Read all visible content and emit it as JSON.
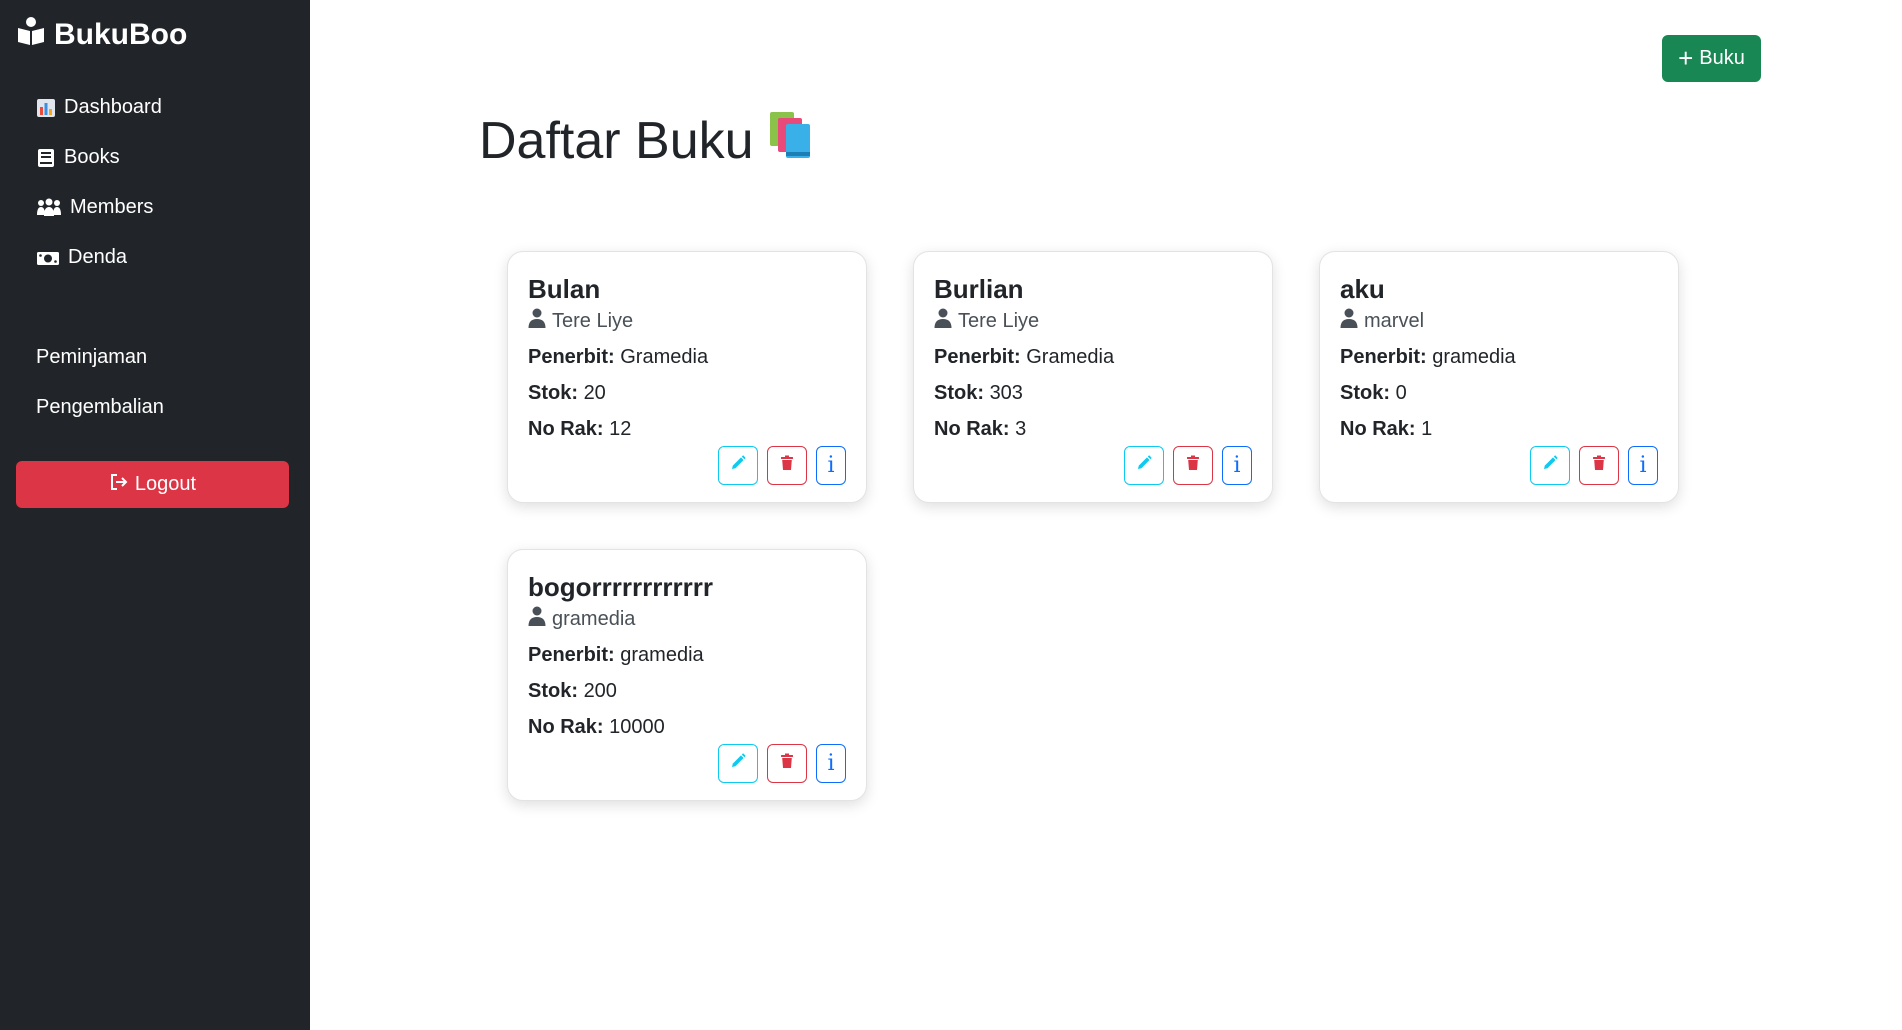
{
  "brand": {
    "name": "BukuBoo",
    "icon": "open-book-reader-icon"
  },
  "sidebar": {
    "items": [
      {
        "label": "Dashboard",
        "icon": "bar-chart-icon"
      },
      {
        "label": "Books",
        "icon": "book-icon"
      },
      {
        "label": "Members",
        "icon": "people-group-icon"
      },
      {
        "label": "Denda",
        "icon": "money-bill-icon"
      },
      {
        "label": "Peminjaman"
      },
      {
        "label": "Pengembalian"
      }
    ],
    "logout_label": "Logout"
  },
  "header": {
    "add_label": "Buku",
    "title": "Daftar Buku"
  },
  "labels": {
    "penerbit": "Penerbit:",
    "stok": "Stok:",
    "no_rak": "No Rak:",
    "info_glyph": "i"
  },
  "books": [
    {
      "title": "Bulan",
      "author": "Tere Liye",
      "penerbit": "Gramedia",
      "stok": "20",
      "no_rak": "12"
    },
    {
      "title": "Burlian",
      "author": "Tere Liye",
      "penerbit": "Gramedia",
      "stok": "303",
      "no_rak": "3"
    },
    {
      "title": "aku",
      "author": "marvel",
      "penerbit": "gramedia",
      "stok": "0",
      "no_rak": "1"
    },
    {
      "title": "bogorrrrrrrrrrrr",
      "author": "gramedia",
      "penerbit": "gramedia",
      "stok": "200",
      "no_rak": "10000"
    }
  ],
  "colors": {
    "sidebar_bg": "#212529",
    "logout": "#dc3545",
    "add_button": "#198754",
    "edit_outline": "#0dcaf0",
    "delete_outline": "#dc3545",
    "info_outline": "#0d6efd"
  }
}
